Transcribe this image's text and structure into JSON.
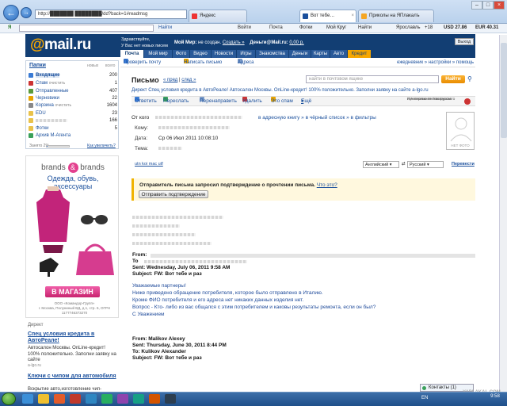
{
  "browser": {
    "address": "http://███████ ████████/dd?back=1#readmsg",
    "tabs": [
      {
        "label": "Яндекс"
      },
      {
        "label": "Вот тебе…"
      },
      {
        "label": "Приколы на ЯПлакалъ"
      }
    ],
    "toolbar": {
      "find_label": "Найти",
      "items": [
        "Войти",
        "Почта",
        "Фотки",
        "Мой Круг",
        "Найти"
      ],
      "city": "Ярославль",
      "temp": "+18",
      "usd": "USD 27.86",
      "eur": "EUR 40.31"
    }
  },
  "mail": {
    "logo_at": "@",
    "logo_text": "mail.ru",
    "header": {
      "greeting": "Здравствуйте,",
      "greeting2": "У Вас нет новых писем",
      "my_world": "Мой Мир:",
      "my_world_status": "не создан.",
      "create": "Создать »",
      "money": "Деньги@Mail.ru:",
      "money_value": "0,00 р.",
      "exit": "Выход"
    },
    "menu": [
      "Почта",
      "Мой мир",
      "Фото",
      "Видео",
      "Новости",
      "Игры",
      "Знакомства",
      "Деньги",
      "Карты",
      "Авто",
      "Кредит"
    ],
    "subnav": {
      "check": "Проверить почту",
      "write": "Написать письмо",
      "addresses": "Адреса",
      "right": "ежедневник » настройки » помощь"
    },
    "folders": {
      "title": "Папки",
      "new": "новых",
      "total": "всего",
      "items": [
        {
          "label": "Входящие",
          "count": "200"
        },
        {
          "label": "Спам",
          "sub": "очистить",
          "count": "1"
        },
        {
          "label": "Отправленные",
          "count": "407"
        },
        {
          "label": "Черновики",
          "count": "22"
        },
        {
          "label": "Корзина",
          "sub": "очистить",
          "count": "1604"
        },
        {
          "label": "EDU",
          "count": "23"
        },
        {
          "label": "",
          "count": "166"
        },
        {
          "label": "Фотки",
          "count": "5"
        },
        {
          "label": "Архив M-Агента",
          "count": ""
        }
      ],
      "used": "Занято 2%",
      "increase": "Как увеличить?"
    },
    "ad": {
      "brand1": "brands",
      "amp": "&",
      "brand2": "brands",
      "title": "Одежда, обувь, аксессуары",
      "button": "В МАГАЗИН",
      "small1": "ООО «Командор-Групп»",
      "small2": "г. Москва, Полуниный ВД, д.1, стр. 6, ОГРН 1177746373270"
    },
    "direct": {
      "label": "Директ",
      "ads": [
        {
          "title": "Спец условия кредита в АвтоРеале!",
          "text": "Автосалон Москвы. OnLine-кредит! 100% положительно. Заполни заявку на сайте",
          "site": "a-lgo.ru"
        },
        {
          "title": "Ключи с чипом для автомобиля",
          "text": "Вскрытие авто,изготовление чип-",
          "site": ""
        }
      ]
    },
    "message": {
      "title": "Письмо",
      "prev": "« пред",
      "next": "след »",
      "search_placeholder": "найти в почтовом ящике",
      "find_button": "Найти",
      "direct_line": "Директ  Спец условия кредита в АвтоРеале!  Автосалон Москвы. OnLine-кредит! 100% положительно. Заполни заявку на сайте  a-lgo.ru",
      "actions": [
        "Ответить",
        "Переслать",
        "Перенаправить",
        "Удалить",
        "Это спам",
        "Ещё"
      ],
      "checked": "Проверено Антивирусом",
      "checked2": "и Антиспамом Касперского",
      "from_label": "От кого",
      "from_links": "в адресную книгу » в чёрный список » в фильтры",
      "to_label": "Кому:",
      "date_label": "Дата:",
      "date_value": "Ср 06 Июл 2011 10:08:10",
      "subject_label": "Тема:",
      "no_photo": "НЕТ ФОТО",
      "encodings": "utn  koi  mac  utf",
      "lang_from": "Английский",
      "lang_to": "Русский",
      "translate": "Перевести",
      "confirm_text": "Отправитель письма запросил подтверждение о прочтении письма.",
      "confirm_why": "Что это?",
      "confirm_button": "Отправить подтверждение",
      "fwd_from": "From:",
      "fwd_to": "To",
      "fwd_sent": "Sent: Wednesday, July 06, 2011 9:58 AM",
      "fwd_subject": "Subject: FW: Вот тебе и раз",
      "body": [
        "Уважаемые партнеры!",
        "Ниже приведено обращение потребителя, которое было отправлено в Италию.",
        "Кроме ФИО потребителя и его адреса нет никаких данных изделия нет.",
        "Вопрос - Кто- либо из вас общался с этим потребителем и каковы результаты ремонта, если он был?",
        "С Уважением"
      ],
      "orig_from": "From: Malikov Alexey",
      "orig_sent": "Sent: Thursday, June 30, 2011 8:44 PM",
      "orig_to": "To: Kulikov Alexander",
      "orig_subject": "Subject: FW: Вот тебе и раз"
    }
  },
  "taskbar": {
    "contacts": "Контакты (1)",
    "watermark": "YAPLAKAL.COM",
    "lang": "EN",
    "time": "9:58"
  }
}
